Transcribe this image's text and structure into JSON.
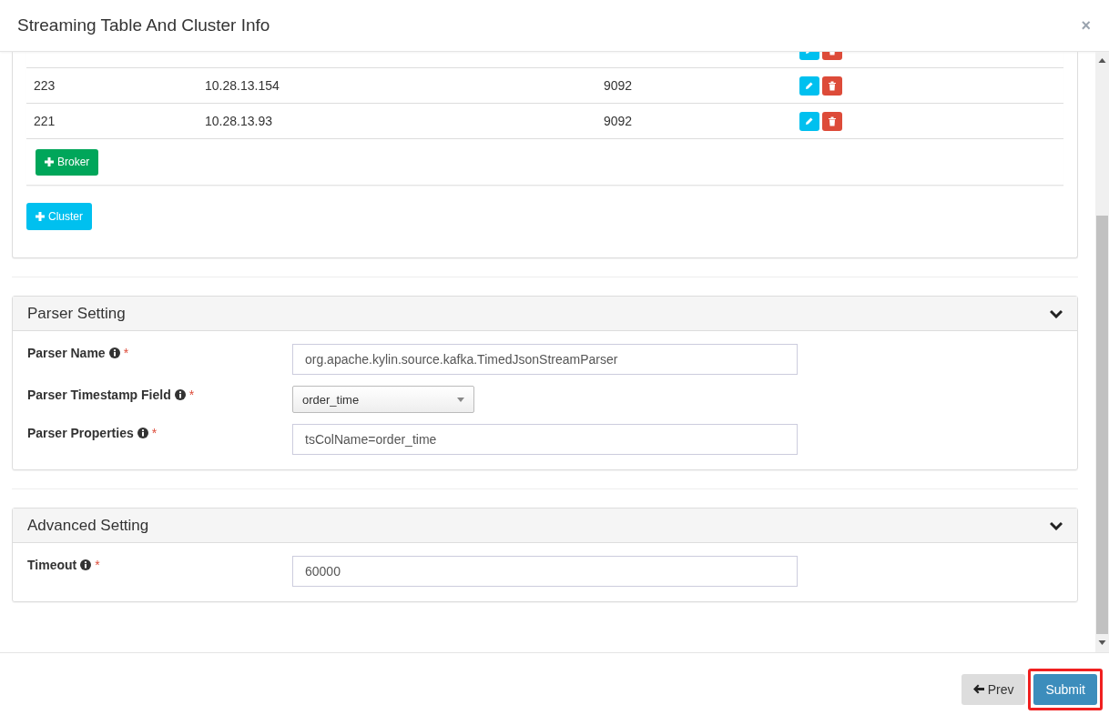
{
  "dialog": {
    "title": "Streaming Table And Cluster Info",
    "close": "×"
  },
  "brokers": {
    "rows": [
      {
        "id": "223",
        "host": "10.28.13.154",
        "port": "9092"
      },
      {
        "id": "221",
        "host": "10.28.13.93",
        "port": "9092"
      }
    ],
    "add_broker": "Broker"
  },
  "add_cluster": "Cluster",
  "sections": [
    {
      "title": "Parser Setting",
      "expanded": true,
      "fields": [
        {
          "label": "Parser Name",
          "required": "*",
          "kind": "text",
          "value": "org.apache.kylin.source.kafka.TimedJsonStreamParser"
        },
        {
          "label": "Parser Timestamp Field",
          "required": "*",
          "kind": "select",
          "value": "order_time"
        },
        {
          "label": "Parser Properties",
          "required": "*",
          "kind": "text",
          "value": "tsColName=order_time"
        }
      ]
    },
    {
      "title": "Advanced Setting",
      "expanded": true,
      "fields": [
        {
          "label": "Timeout",
          "required": "*",
          "kind": "text",
          "value": "60000"
        }
      ]
    }
  ],
  "footer": {
    "prev": "Prev",
    "submit": "Submit",
    "submit_highlighted": true
  }
}
